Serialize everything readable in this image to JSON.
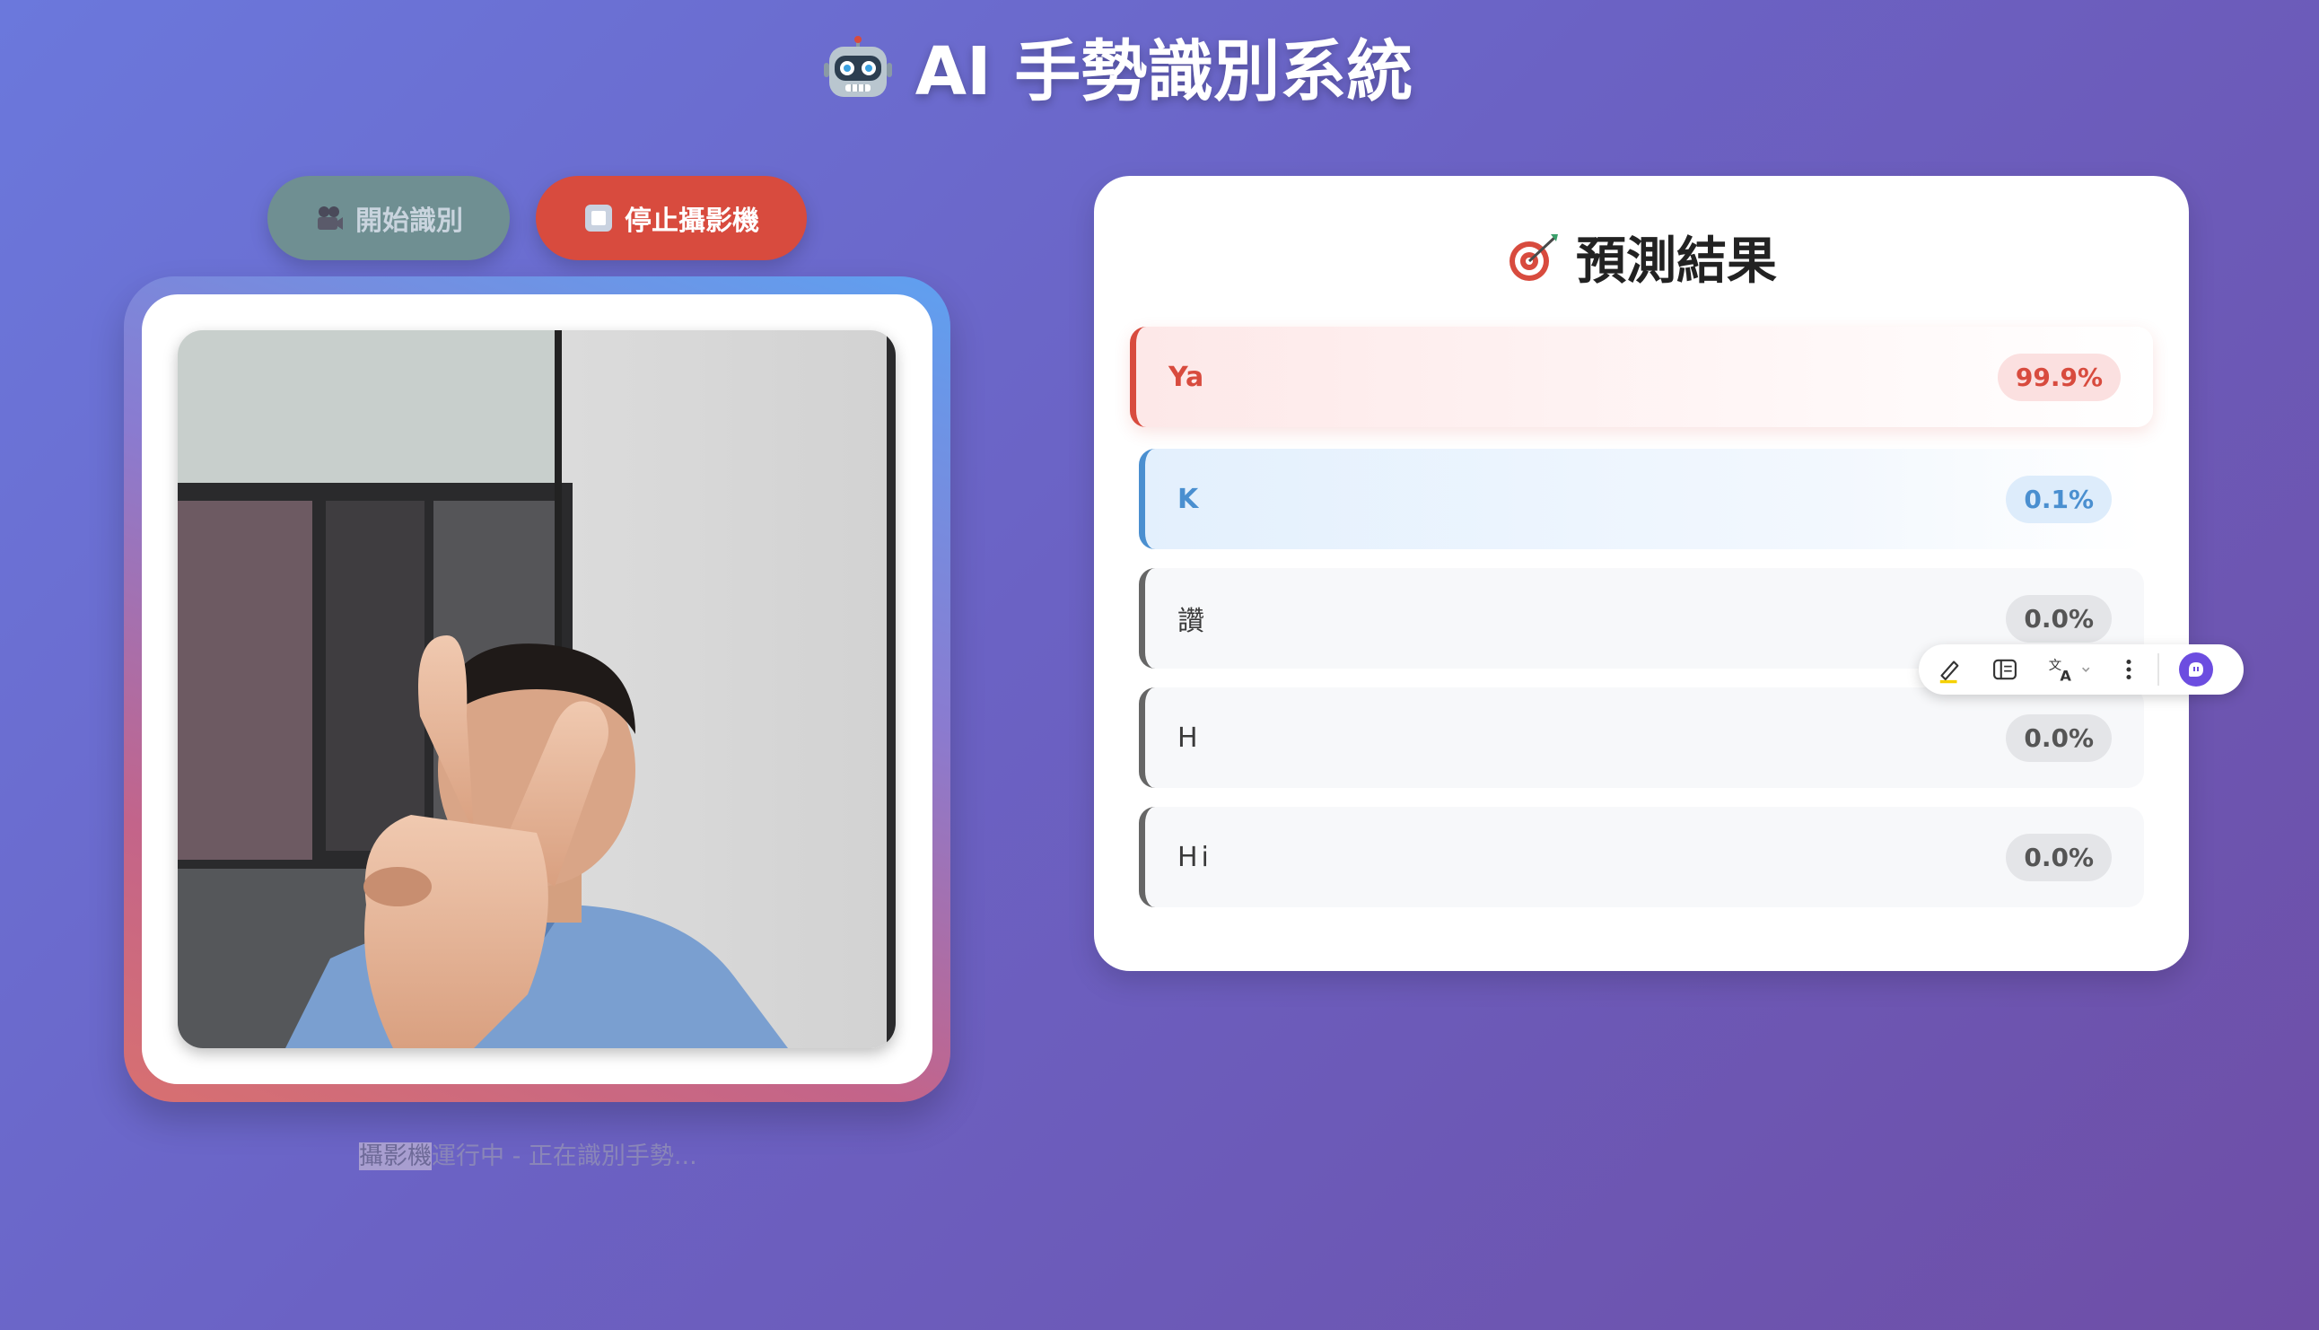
{
  "header": {
    "title": "AI 手勢識別系統",
    "icon": "robot-icon"
  },
  "controls": {
    "start_label": "開始識別",
    "start_icon": "film-camera-icon",
    "stop_label": "停止攝影機",
    "stop_icon": "stop-square-icon"
  },
  "camera": {
    "status_highlight": "攝影機",
    "status_rest": "運行中 - 正在識別手勢..."
  },
  "predictions": {
    "title": "預測結果",
    "icon": "target-icon",
    "items": [
      {
        "label": "Ya",
        "percent": "99.9%"
      },
      {
        "label": "K",
        "percent": "0.1%"
      },
      {
        "label": "讚",
        "percent": "0.0%"
      },
      {
        "label": "H",
        "percent": "0.0%"
      },
      {
        "label": "Hi",
        "percent": "0.0%"
      }
    ]
  },
  "toolbar": {
    "icons": [
      "highlighter-icon",
      "sidebar-panel-icon",
      "translate-icon",
      "more-vertical-icon",
      "assistant-logo-icon"
    ]
  },
  "colors": {
    "accent_red": "#d84b3e",
    "accent_blue": "#4a8fd0",
    "start_button": "#6f8f92",
    "brand_purple": "#6c4de0"
  }
}
